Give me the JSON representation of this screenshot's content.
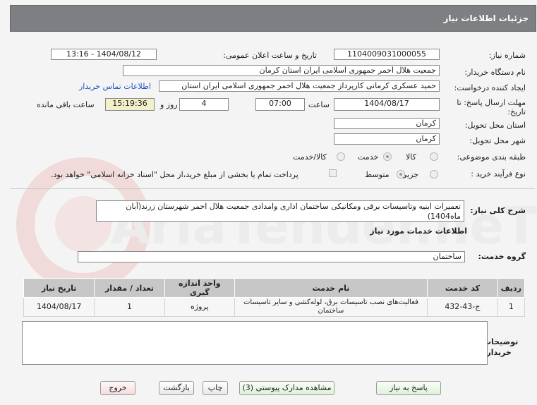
{
  "header": {
    "title": "جزئیات اطلاعات نیاز"
  },
  "form": {
    "need_number_label": "شماره نیاز:",
    "need_number": "1104009031000055",
    "announce_label": "تاریخ و ساعت اعلان عمومی:",
    "announce_value": "1404/08/12 - 13:16",
    "buyer_org_label": "نام دستگاه خریدار:",
    "buyer_org": "جمعیت هلال احمر جمهوری اسلامی ایران استان کرمان",
    "creator_label": "ایجاد کننده درخواست:",
    "creator": "حمید عسکری کرمانی کارپرداز جمعیت هلال احمر جمهوری اسلامی ایران استان",
    "contact_link": "اطلاعات تماس خریدار",
    "deadline_label_1": "مهلت ارسال پاسخ: تا",
    "deadline_label_2": "تاریخ:",
    "deadline_date": "1404/08/17",
    "time_label": "ساعت",
    "deadline_time": "07:00",
    "days_value": "4",
    "days_label": "روز و",
    "remaining_time": "15:19:36",
    "remaining_label": "ساعت باقی مانده",
    "province_label": "استان محل تحویل:",
    "province": "کرمان",
    "city_label": "شهر محل تحویل:",
    "city": "کرمان",
    "category_label": "طبقه بندی موضوعی:",
    "category_options": [
      "کالا",
      "خدمت",
      "کالا/خدمت"
    ],
    "category_selected": "خدمت",
    "process_label": "نوع فرآیند خرید :",
    "process_options": [
      "جزیی",
      "متوسط"
    ],
    "process_selected": "متوسط",
    "payment_note": "پرداخت تمام یا بخشی از مبلغ خرید،از محل \"اسناد خزانه اسلامی\" خواهد بود."
  },
  "description": {
    "label": "شرح کلی نیاز:",
    "text": "تعمیرات ابنیه وتاسیسات برقی ومکانیکی ساختمان اداری وامدادی جمعیت هلال احمر شهرستان زرند(آبان ماه1404)"
  },
  "services": {
    "section_title": "اطلاعات خدمات مورد نیاز",
    "group_label": "گروه خدمت:",
    "group_value": "ساختمان",
    "columns": [
      "ردیف",
      "کد خدمت",
      "نام خدمت",
      "واحد اندازه گیری",
      "تعداد / مقدار",
      "تاریخ نیاز"
    ],
    "rows": [
      {
        "row": "1",
        "code": "ج-43-432",
        "name": "فعالیت‌های نصب تاسیسات برق، لوله‌کشی و سایر تاسیسات ساختمان",
        "unit": "پروژه",
        "qty": "1",
        "date": "1404/08/17"
      }
    ]
  },
  "buyer_notes": {
    "label": "توضیحات خریدار:",
    "value": ""
  },
  "buttons": {
    "reply": "پاسخ به نیاز",
    "docs": "مشاهده مدارک پیوستی (3)",
    "print": "چاپ",
    "back": "بازگشت",
    "exit": "خروج"
  },
  "watermark": {
    "text": "AriaTender.neT"
  }
}
